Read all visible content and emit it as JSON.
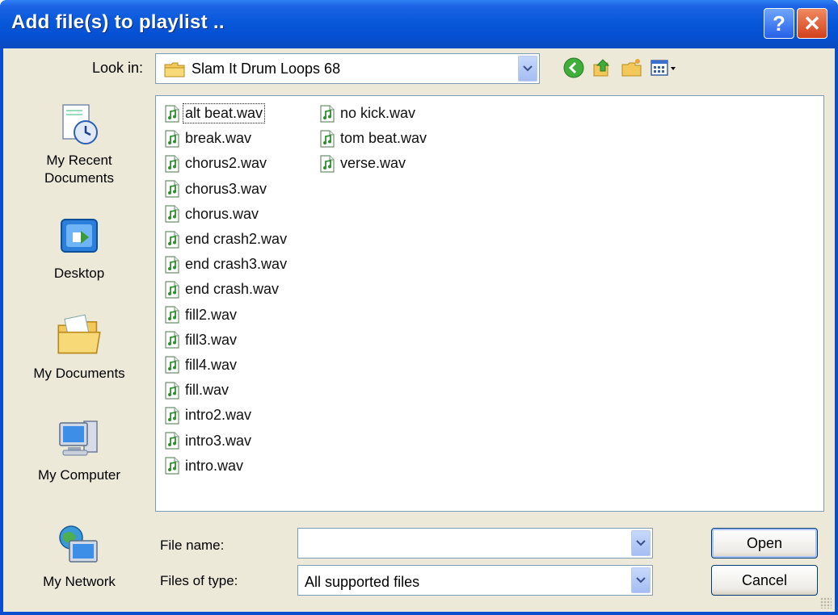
{
  "window": {
    "title": "Add file(s) to playlist ..",
    "help_label": "?",
    "close_label": "✕"
  },
  "lookin": {
    "label": "Look in:",
    "value": "Slam It Drum Loops 68"
  },
  "places": [
    {
      "label_line1": "My Recent",
      "label_line2": "Documents",
      "icon": "recent-documents-icon"
    },
    {
      "label_line1": "Desktop",
      "label_line2": "",
      "icon": "desktop-icon"
    },
    {
      "label_line1": "My Documents",
      "label_line2": "",
      "icon": "my-documents-icon"
    },
    {
      "label_line1": "My Computer",
      "label_line2": "",
      "icon": "my-computer-icon"
    },
    {
      "label_line1": "My Network",
      "label_line2": "",
      "icon": "my-network-icon"
    }
  ],
  "files": {
    "column1": [
      "alt beat.wav",
      "break.wav",
      "chorus2.wav",
      "chorus3.wav",
      "chorus.wav",
      "end crash2.wav",
      "end crash3.wav",
      "end crash.wav",
      "fill2.wav",
      "fill3.wav",
      "fill4.wav",
      "fill.wav",
      "intro2.wav",
      "intro3.wav",
      "intro.wav"
    ],
    "column2": [
      "no kick.wav",
      "tom beat.wav",
      "verse.wav"
    ]
  },
  "filename": {
    "label": "File name:",
    "value": ""
  },
  "filetype": {
    "label": "Files of type:",
    "value": "All supported files"
  },
  "buttons": {
    "open": "Open",
    "cancel": "Cancel"
  },
  "colors": {
    "titlebar": "#0858da",
    "dialog_bg": "#ece9d8",
    "close_button": "#d3401d",
    "file_icon": "#3a8c3a"
  }
}
